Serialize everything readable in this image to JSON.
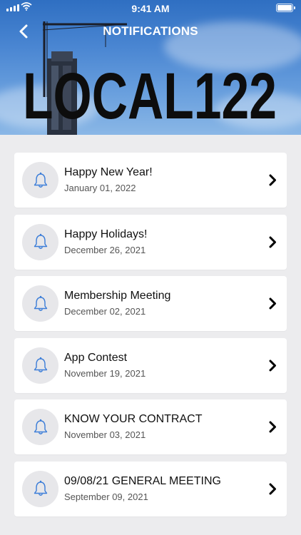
{
  "status_bar": {
    "time": "9:41 AM"
  },
  "header": {
    "title": "NOTIFICATIONS",
    "logo_text": "LOCAL122"
  },
  "notifications": [
    {
      "title": "Happy New Year!",
      "date": "January 01, 2022"
    },
    {
      "title": "Happy Holidays!",
      "date": "December 26, 2021"
    },
    {
      "title": "Membership Meeting",
      "date": "December 02, 2021"
    },
    {
      "title": "App Contest",
      "date": "November 19, 2021"
    },
    {
      "title": "KNOW YOUR CONTRACT",
      "date": "November 03, 2021"
    },
    {
      "title": "09/08/21 GENERAL MEETING",
      "date": "September 09, 2021"
    }
  ],
  "colors": {
    "bell": "#3b7dd8",
    "background": "#ececee",
    "card": "#ffffff"
  },
  "icons": {
    "back": "chevron-left-icon",
    "bell": "bell-icon",
    "row": "chevron-right-icon"
  }
}
